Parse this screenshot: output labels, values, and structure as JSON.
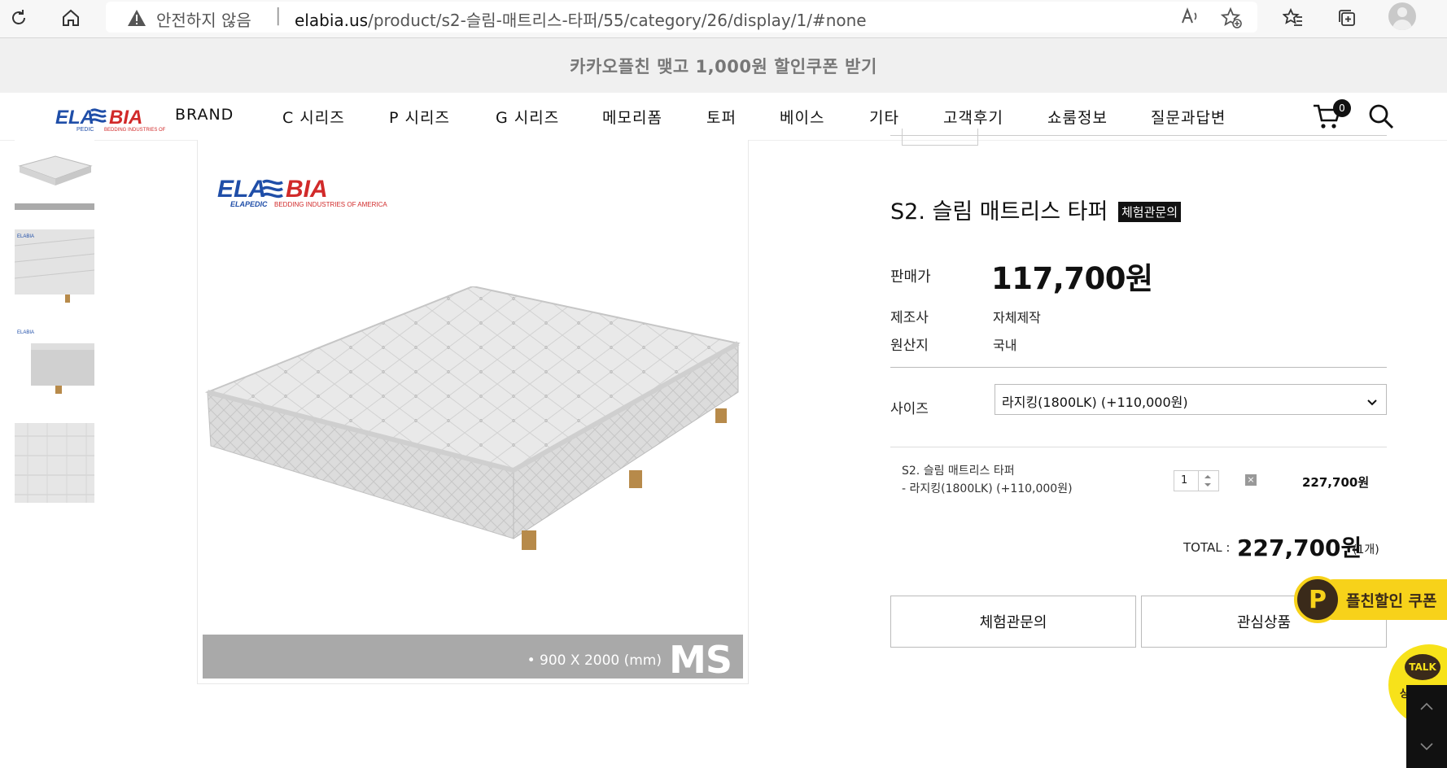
{
  "browser": {
    "security_text": "안전하지 않음",
    "separator": "|",
    "url_host": "elabia.us",
    "url_path": "/product/s2-슬림-매트리스-타퍼/55/category/26/display/1/#none"
  },
  "promo": {
    "text": "카카오플친 맺고 1,000원 할인쿠폰 받기"
  },
  "nav": {
    "items": [
      "BRAND",
      "C 시리즈",
      "P 시리즈",
      "G 시리즈",
      "메모리폼",
      "토퍼",
      "베이스",
      "기타",
      "고객후기",
      "쇼룸정보",
      "질문과답변"
    ],
    "cart_count": "0"
  },
  "gallery": {
    "logo_text": "ELABIA",
    "logo_sub": "ELAPEDIC",
    "logo_tagline": "BEDDING INDUSTRIES OF AMERICA",
    "size_text": "• 900 X 2000 (mm)",
    "size_code": "MS"
  },
  "product": {
    "title": "S2. 슬림 매트리스 타퍼",
    "badge": "체험관문의",
    "price_label": "판매가",
    "price": "117,700원",
    "maker_label": "제조사",
    "maker": "자체제작",
    "origin_label": "원산지",
    "origin": "국내",
    "size_label": "사이즈",
    "size_selected": "라지킹(1800LK) (+110,000원)"
  },
  "selection": {
    "name": "S2. 슬림 매트리스 타퍼",
    "option": "- 라지킹(1800LK) (+110,000원)",
    "qty": "1",
    "delete": "×",
    "line_price": "227,700원"
  },
  "total": {
    "label": "TOTAL :",
    "value": "227,700원",
    "count": "(1개)"
  },
  "buttons": {
    "inquiry": "체험관문의",
    "wishlist": "관심상품"
  },
  "floating": {
    "coupon_icon": "P",
    "coupon": "플친할인 쿠폰",
    "talk": "TALK",
    "talk_sub": "상담"
  },
  "colors": {
    "accent": "#111111",
    "kakao_yellow": "#f7d21a",
    "logo_red": "#d12a2a",
    "logo_blue": "#1f4ea8"
  }
}
